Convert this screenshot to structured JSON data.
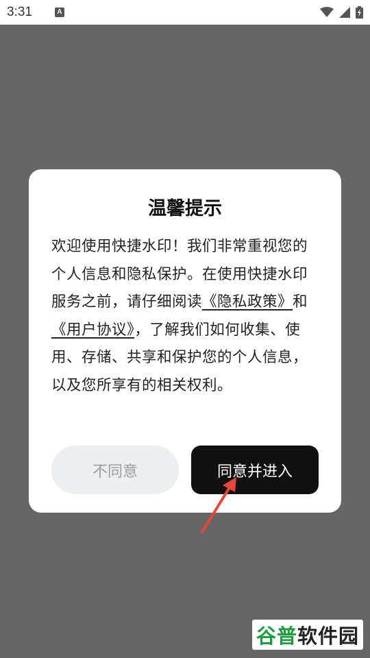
{
  "status_bar": {
    "time": "3:31",
    "a_icon_glyph": "A",
    "icons": [
      "a-icon",
      "wifi-icon",
      "signal-icon",
      "battery-icon"
    ]
  },
  "dialog": {
    "title": "温馨提示",
    "body": {
      "text_before_link1": "欢迎使用快捷水印！我们非常重视您的个人信息和隐私保护。在使用快捷水印服务之前，请仔细阅读",
      "link_privacy": "《隐私政策》",
      "text_and": "和",
      "link_user_agreement": "《用户协议》",
      "text_after": "，了解我们如何收集、使用、存储、共享和保护您的个人信息，以及您所享有的相关权利。"
    },
    "disagree_label": "不同意",
    "agree_label": "同意并进入"
  },
  "watermark": {
    "part1": "谷普",
    "part2": "软件园"
  },
  "colors": {
    "overlay": "#666666",
    "agree_bg": "#111111",
    "disagree_bg": "#eceef0",
    "arrow": "#e8453c",
    "watermark_green": "#1f9b3f"
  }
}
